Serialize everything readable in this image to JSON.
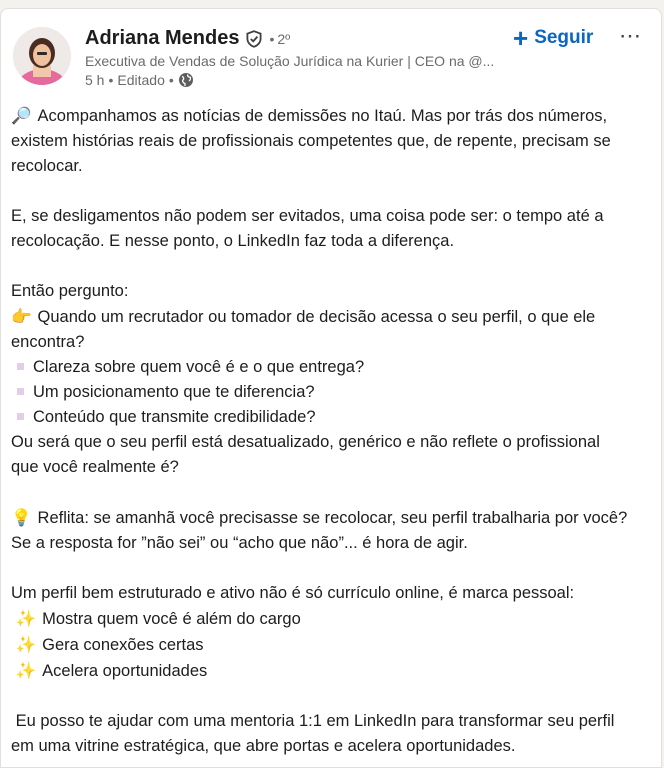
{
  "author": {
    "name": "Adriana Mendes",
    "separator": "•",
    "degree": "2º",
    "headline": "Executiva de Vendas de Solução Jurídica na Kurier | CEO na @...",
    "time": "5 h",
    "dot": "•",
    "edited": "Editado",
    "icons": {
      "verified": "verified-shield-icon",
      "visibility": "globe-icon"
    }
  },
  "actions": {
    "follow_label": "Seguir",
    "more_label": "⋯"
  },
  "colors": {
    "accent": "#0a66c2",
    "muted": "#6b6b6b",
    "text": "#1d1d1d"
  },
  "post": {
    "p1": [
      "Acompanhamos as notícias de demissões no Itaú. Mas por trás dos números,",
      "existem histórias reais de profissionais competentes que, de repente, precisam se",
      "recolocar."
    ],
    "p2": [
      "E, se desligamentos não podem ser evitados, uma coisa pode ser: o tempo até a",
      "recolocação. E nesse ponto, o LinkedIn faz toda a diferença."
    ],
    "p3_intro": "Então pergunto:",
    "p3_question": [
      "Quando um recrutador ou tomador de decisão acessa o seu perfil, o que ele",
      "encontra?"
    ],
    "p3_items": [
      "Clareza sobre quem você é e o que entrega?",
      "Um posicionamento que te diferencia?",
      "Conteúdo que transmite credibilidade?"
    ],
    "p3_outro": [
      "Ou será que o seu perfil está desatualizado, genérico e não reflete o profissional",
      "que você realmente é?"
    ],
    "p4": [
      "Reflita: se amanhã você precisasse se recolocar, seu perfil trabalharia por você?",
      "Se a resposta for ”não sei” ou “acho que não”... é hora de agir."
    ],
    "p5_intro": "Um perfil bem estruturado e ativo não é só currículo online, é marca pessoal:",
    "p5_items": [
      "Mostra quem você é além do cargo",
      "Gera conexões certas",
      "Acelera oportunidades"
    ],
    "p6": [
      " Eu posso te ajudar com uma mentoria 1:1 em LinkedIn para transformar seu perfil",
      "em uma vitrine estratégica, que abre portas e acelera oportunidades."
    ],
    "emoji": {
      "magnifier": "🔎",
      "pointing_hand": "👉",
      "bulb": "💡",
      "sparkles": "✨"
    }
  }
}
